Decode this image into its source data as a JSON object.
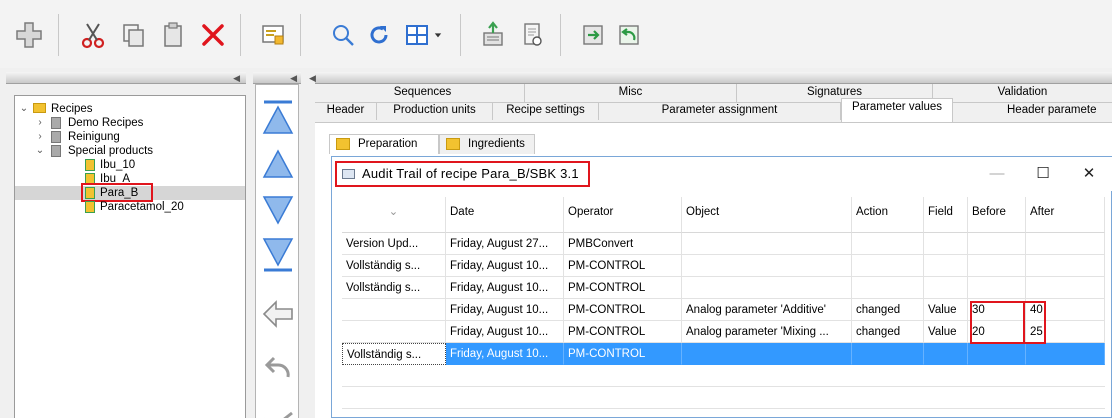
{
  "toolbar": {
    "buttons": [
      "add-icon",
      "cut-icon",
      "copy-icon",
      "paste-icon",
      "delete-icon",
      "properties-icon",
      "search-icon",
      "refresh-icon",
      "view-grid-icon",
      "dropdown-arrow-icon",
      "export-icon",
      "preview-icon",
      "import-icon",
      "undo-icon"
    ]
  },
  "tree": {
    "items": [
      {
        "label": "Recipes",
        "level": 0,
        "expanded": true
      },
      {
        "label": "Demo Recipes",
        "level": 1,
        "expanded": false
      },
      {
        "label": "Reinigung",
        "level": 1,
        "expanded": false
      },
      {
        "label": "Special products",
        "level": 1,
        "expanded": true
      },
      {
        "label": "Ibu_10",
        "level": 2
      },
      {
        "label": "Ibu_A",
        "level": 2
      },
      {
        "label": "Para_B",
        "level": 2,
        "selected": true
      },
      {
        "label": "Paracetamol_20",
        "level": 2
      }
    ]
  },
  "tabs": {
    "row1": [
      "Sequences",
      "Misc",
      "Signatures",
      "Validation"
    ],
    "row2": [
      "Header",
      "Production units",
      "Recipe settings",
      "Parameter assignment",
      "Parameter values",
      "Header paramete"
    ],
    "active": "Parameter values"
  },
  "subtabs": [
    "Preparation",
    "Ingredients"
  ],
  "audit": {
    "title": "Audit Trail of recipe Para_B/SBK 3.1",
    "min": "—",
    "max": "☐",
    "close": "✕",
    "columns": [
      "",
      "Date",
      "Operator",
      "Object",
      "Action",
      "Field",
      "Before",
      "After"
    ],
    "rows": [
      [
        "Version Upd...",
        "Friday, August 27...",
        "PMBConvert",
        "",
        "",
        "",
        "",
        ""
      ],
      [
        "Vollständig s...",
        "Friday, August 10...",
        "PM-CONTROL",
        "",
        "",
        "",
        "",
        ""
      ],
      [
        "Vollständig s...",
        "Friday, August 10...",
        "PM-CONTROL",
        "",
        "",
        "",
        "",
        ""
      ],
      [
        "",
        "Friday, August 10...",
        "PM-CONTROL",
        "Analog parameter 'Additive'",
        "changed",
        "Value",
        "30",
        "40"
      ],
      [
        "",
        "Friday, August 10...",
        "PM-CONTROL",
        "Analog parameter 'Mixing ...",
        "changed",
        "Value",
        "20",
        "25"
      ],
      [
        "Vollständig s...",
        "Friday, August 10...",
        "PM-CONTROL",
        "",
        "",
        "",
        "",
        ""
      ]
    ],
    "selected_row": 5
  },
  "colors": {
    "highlight": "#3399ff",
    "annotation": "#e0151d",
    "folder": "#f2c230",
    "arrow_blue": "#3a7bd5"
  }
}
